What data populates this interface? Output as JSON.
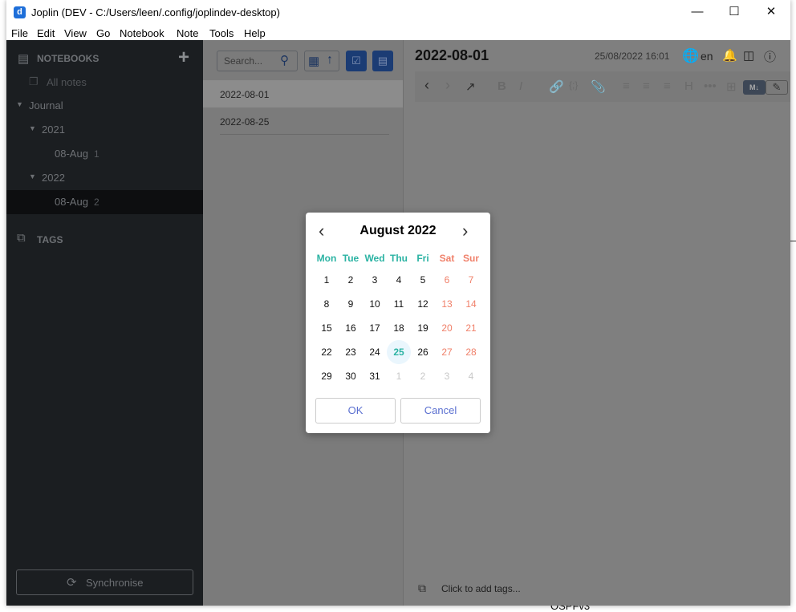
{
  "window": {
    "title": "Joplin (DEV - C:/Users/leen/.config/joplindev-desktop)",
    "app_icon": "joplin-icon",
    "controls": [
      "minimize",
      "maximize",
      "close"
    ]
  },
  "menu": [
    "File",
    "Edit",
    "View",
    "Go",
    "Notebook",
    "Note",
    "Tools",
    "Help"
  ],
  "sidebar": {
    "notebooks_label": "NOTEBOOKS",
    "all_notes": "All notes",
    "journal": "Journal",
    "y2021": "2021",
    "aug2021": "08-Aug",
    "aug2021_count": "1",
    "y2022": "2022",
    "aug2022": "08-Aug",
    "aug2022_count": "2",
    "tags_label": "TAGS",
    "sync_label": "Synchronise"
  },
  "notelist": {
    "search_placeholder": "Search...",
    "notes": [
      "2022-08-01",
      "2022-08-25"
    ]
  },
  "editor": {
    "title": "2022-08-01",
    "date": "25/08/2022 16:01",
    "lang": "en",
    "md_label": "M↓",
    "tags_placeholder": "Click to add tags..."
  },
  "background": {
    "text": "OSPFv3"
  },
  "calendar": {
    "month_title": "August 2022",
    "weekdays": [
      "Mon",
      "Tue",
      "Wed",
      "Thu",
      "Fri",
      "Sat",
      "Sun"
    ],
    "weeks": [
      [
        "1",
        "2",
        "3",
        "4",
        "5",
        "6",
        "7"
      ],
      [
        "8",
        "9",
        "10",
        "11",
        "12",
        "13",
        "14"
      ],
      [
        "15",
        "16",
        "17",
        "18",
        "19",
        "20",
        "21"
      ],
      [
        "22",
        "23",
        "24",
        "25",
        "26",
        "27",
        "28"
      ],
      [
        "29",
        "30",
        "31",
        "1",
        "2",
        "3",
        "4"
      ]
    ],
    "selected": "25",
    "ok_label": "OK",
    "cancel_label": "Cancel",
    "colors": {
      "weekday": "#2bb3a3",
      "weekend": "#f0806a",
      "selected_bg": "#eaf6fd",
      "muted": "#c8c8c8"
    }
  }
}
